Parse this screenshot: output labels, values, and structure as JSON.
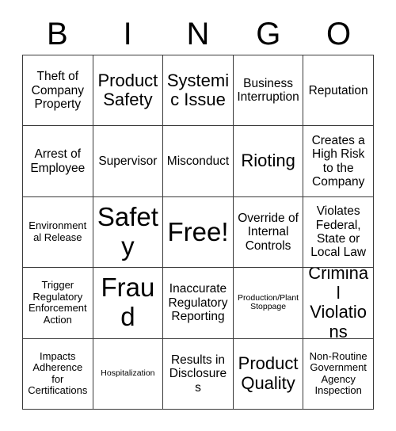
{
  "card": {
    "header_letters": [
      "B",
      "I",
      "N",
      "G",
      "O"
    ],
    "rows": [
      [
        {
          "text": "Theft of Company Property",
          "size": "md"
        },
        {
          "text": "Product Safety",
          "size": "lg"
        },
        {
          "text": "Systemic Issue",
          "size": "lg"
        },
        {
          "text": "Business Interruption",
          "size": "md"
        },
        {
          "text": "Reputation",
          "size": "md"
        }
      ],
      [
        {
          "text": "Arrest of Employee",
          "size": "md"
        },
        {
          "text": "Supervisor",
          "size": "md"
        },
        {
          "text": "Misconduct",
          "size": "md"
        },
        {
          "text": "Rioting",
          "size": "lg"
        },
        {
          "text": "Creates a High Risk to the Company",
          "size": "md"
        }
      ],
      [
        {
          "text": "Environmental Release",
          "size": "sm"
        },
        {
          "text": "Safety",
          "size": "xl"
        },
        {
          "text": "Free!",
          "size": "xl"
        },
        {
          "text": "Override of Internal Controls",
          "size": "md"
        },
        {
          "text": "Violates Federal, State or Local Law",
          "size": "md"
        }
      ],
      [
        {
          "text": "Trigger Regulatory Enforcement Action",
          "size": "sm"
        },
        {
          "text": "Fraud",
          "size": "xl"
        },
        {
          "text": "Inaccurate Regulatory Reporting",
          "size": "md"
        },
        {
          "text": "Production/Plant Stoppage",
          "size": "xs"
        },
        {
          "text": "Criminal Violations",
          "size": "lg"
        }
      ],
      [
        {
          "text": "Impacts Adherence for Certifications",
          "size": "sm"
        },
        {
          "text": "Hospitalization",
          "size": "xs"
        },
        {
          "text": "Results in Disclosures",
          "size": "md"
        },
        {
          "text": "Product Quality",
          "size": "lg"
        },
        {
          "text": "Non-Routine Government Agency Inspection",
          "size": "sm"
        }
      ]
    ],
    "colors": {
      "background": "#ffffff",
      "text": "#000000",
      "grid_line": "#3a3a3a"
    }
  }
}
